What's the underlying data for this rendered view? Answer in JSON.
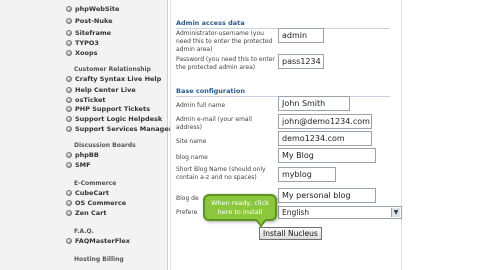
{
  "sidebar": {
    "items_top": [
      {
        "label": "phpWebSite"
      },
      {
        "label": "Post-Nuke"
      },
      {
        "label": "Siteframe"
      },
      {
        "label": "TYPO3"
      },
      {
        "label": "Xoops"
      }
    ],
    "sections": [
      {
        "title": "Customer Relationship",
        "items": [
          {
            "label": "Crafty Syntax Live Help"
          },
          {
            "label": "Help Center Live"
          },
          {
            "label": "osTicket"
          },
          {
            "label": "PHP Support Tickets"
          },
          {
            "label": "Support Logic Helpdesk"
          },
          {
            "label": "Support Services Manager"
          }
        ]
      },
      {
        "title": "Discussion Boards",
        "items": [
          {
            "label": "phpBB"
          },
          {
            "label": "SMF"
          }
        ]
      },
      {
        "title": "E-Commerce",
        "items": [
          {
            "label": "CubeCart"
          },
          {
            "label": "OS Commerce"
          },
          {
            "label": "Zen Cart"
          }
        ]
      },
      {
        "title": "F.A.Q.",
        "items": [
          {
            "label": "FAQMasterFlex"
          }
        ]
      },
      {
        "title": "Hosting Billing",
        "items": []
      }
    ]
  },
  "form": {
    "admin_section": {
      "title": "Admin access data",
      "fields": [
        {
          "label": "Administrator-username (you need this to enter the protected admin area)",
          "value": "admin"
        },
        {
          "label": "Password (you need this to enter the protected admin area)",
          "value": "pass1234"
        }
      ]
    },
    "base_section": {
      "title": "Base configuration",
      "fields": [
        {
          "label": "Admin full name",
          "value": "John Smith"
        },
        {
          "label": "Admin e-mail (your email address)",
          "value": "john@demo1234.com"
        },
        {
          "label": "Site name",
          "value": "demo1234.com"
        },
        {
          "label": "blog name",
          "value": "My Blog"
        },
        {
          "label": "Short Blog Name (should only contain a-z and no spaces)",
          "value": "myblog"
        },
        {
          "label": "Blog de",
          "value": "My personal blog"
        },
        {
          "label": "Prefere",
          "value": "English"
        }
      ]
    },
    "install_button": "Install Nucleus"
  },
  "tooltip": {
    "text": "When ready, click here to install"
  },
  "colors": {
    "section_title": "#2b5a8a",
    "tooltip_bg": "#8cc63f",
    "tooltip_border": "#5d9424",
    "sidebar_bg": "#f3f3f3"
  }
}
